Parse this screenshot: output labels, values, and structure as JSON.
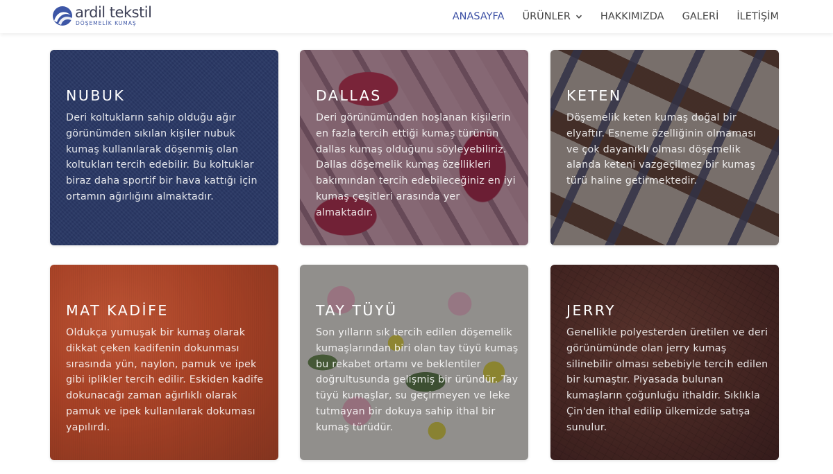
{
  "header": {
    "logo": {
      "name": "ardil tekstil",
      "tagline": "DÖŞEMELİK KUMAŞ",
      "icon": "wave-logo-icon"
    },
    "nav": [
      {
        "label": "ANASAYFA",
        "active": true
      },
      {
        "label": "ÜRÜNLER",
        "has_dropdown": true,
        "icon": "chevron-down-icon"
      },
      {
        "label": "HAKKIMIZDA"
      },
      {
        "label": "GALERİ"
      },
      {
        "label": "İLETİŞİM"
      }
    ]
  },
  "colors": {
    "accent": "#3b4fa4",
    "nav_text": "#444444",
    "card_text": "#ffffff"
  },
  "cards": [
    {
      "title": "NUBUK",
      "text": "Deri koltukların sahip olduğu ağır görünümden sıkılan kişiler nubuk kumaş kullanılarak döşenmiş olan koltukları tercih edebilir. Bu koltuklar biraz daha sportif bir hava kattığı için ortamın ağırlığını almaktadır."
    },
    {
      "title": "DALLAS",
      "text": "Deri görünümünden hoşlanan kişilerin en fazla tercih ettiği kumaş türünün dallas kumaş olduğunu söyleyebiliriz. Dallas döşemelik kumaş özellikleri bakımından tercih edebileceğiniz en iyi kumaş çeşitleri arasında yer almaktadır."
    },
    {
      "title": "KETEN",
      "text": "Döşemelik keten kumaş doğal bir elyaftır. Esneme özelliğinin olmaması ve çok dayanıklı olması döşemelik alanda keteni vazgeçilmez bir kumaş türü haline getirmektedir."
    },
    {
      "title": "MAT KADİFE",
      "text": "Oldukça yumuşak bir kumaş olarak dikkat çeken kadifenin dokunması sırasında yün, naylon, pamuk ve ipek gibi iplikler tercih edilir. Eskiden kadife dokunacağı zaman ağırlıklı olarak pamuk ve ipek kullanılarak dokuması yapılırdı."
    },
    {
      "title": "TAY TÜYÜ",
      "text": "Son yılların sık tercih edilen döşemelik kumaşlarından biri olan tay tüyü kumaş bu rekabet ortamı ve beklentiler doğrultusunda gelişmiş bir üründür. Tay tüyü kumaşlar, su geçirmeyen ve leke tutmayan bir dokuya sahip ithal bir kumaş türüdür."
    },
    {
      "title": "JERRY",
      "text": "Genellikle polyesterden üretilen ve deri görünümünde olan jerry kumaş silinebilir olması sebebiyle tercih edilen bir kumaştır. Piyasada bulunan kumaşların çoğunluğu ithaldir. Sıklıkla Çin'den ithal edilip ülkemizde satışa sunulur."
    }
  ]
}
